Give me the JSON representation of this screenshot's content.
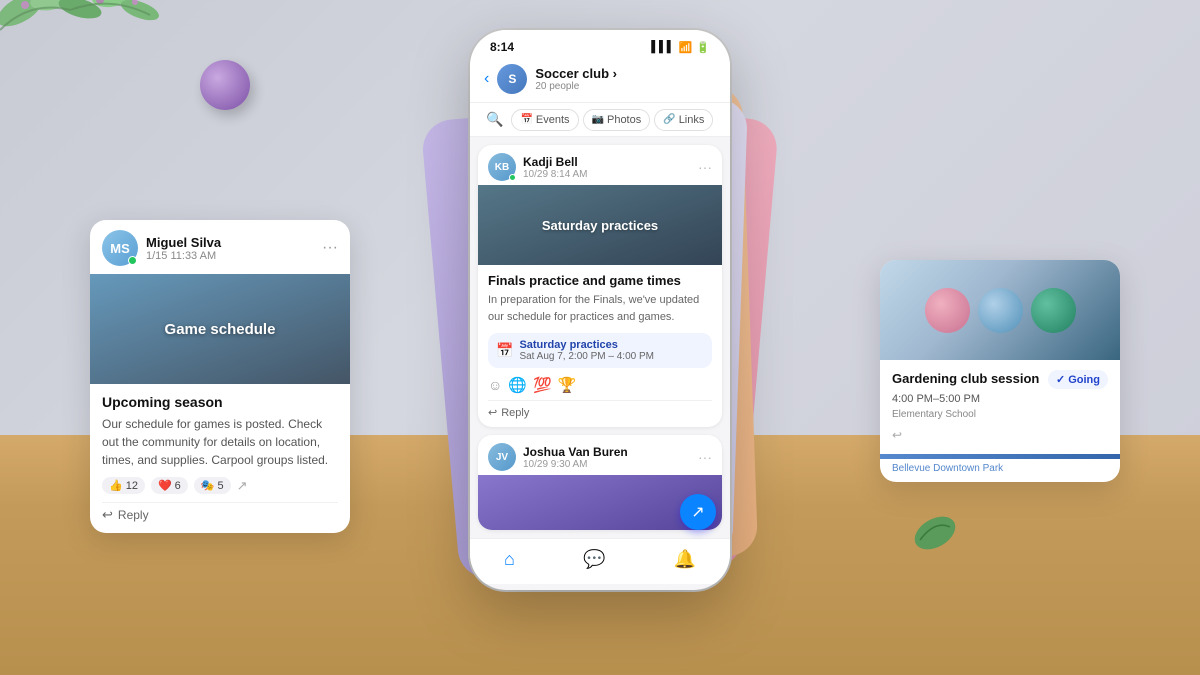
{
  "background": {
    "color": "#d0d2dc"
  },
  "phone": {
    "status_time": "8:14",
    "group_name": "Soccer club",
    "group_chevron": ">",
    "group_people": "20 people",
    "tabs": [
      {
        "label": "Events",
        "icon": "📅"
      },
      {
        "label": "Photos",
        "icon": "📷"
      },
      {
        "label": "Links",
        "icon": "🔗"
      }
    ],
    "messages": [
      {
        "user": "Kadji Bell",
        "avatar_initials": "KB",
        "time": "10/29 8:14 AM",
        "banner_text": "Saturday practices",
        "title": "Finals practice and game times",
        "desc": "In preparation for the Finals, we've updated our schedule for practices and games.",
        "event_name": "Saturday practices",
        "event_time": "Sat Aug 7, 2:00 PM – 4:00 PM",
        "reactions": [
          "🌐",
          "💯",
          "🏆"
        ],
        "reply_label": "Reply"
      },
      {
        "user": "Joshua Van Buren",
        "avatar_initials": "JV",
        "time": "10/29 9:30 AM",
        "banner_text": ""
      }
    ],
    "bottom_nav": [
      {
        "icon": "⌂",
        "label": "Home",
        "active": true
      },
      {
        "icon": "💬",
        "label": "Chat",
        "active": false
      },
      {
        "icon": "🔔",
        "label": "Notifications",
        "active": false
      }
    ]
  },
  "card_left": {
    "user": "Miguel Silva",
    "avatar_initials": "MS",
    "time": "1/15 11:33 AM",
    "banner_text": "Game schedule",
    "title": "Upcoming season",
    "desc": "Our schedule for games is posted. Check out the community for details on location, times, and supplies. Carpool groups listed.",
    "reactions": [
      {
        "emoji": "👍",
        "count": "12"
      },
      {
        "emoji": "❤️",
        "count": "6"
      },
      {
        "emoji": "🎭",
        "count": "5"
      }
    ],
    "reply_label": "Reply"
  },
  "card_right": {
    "title": "Gardening club session",
    "time": "4:00 PM–5:00 PM",
    "going_label": "Going",
    "location1": "Elementary School",
    "location2": "Bellevue Downtown Park"
  },
  "decorations": {
    "ball_color": "#9966cc"
  }
}
